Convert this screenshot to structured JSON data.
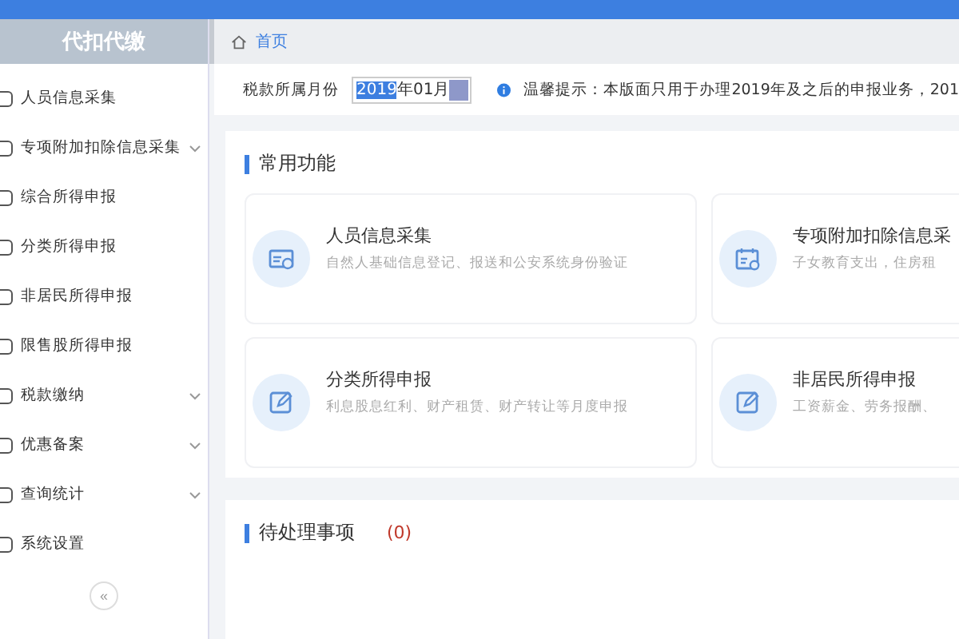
{
  "sidebar": {
    "title": "代扣代缴",
    "items": [
      {
        "label": "人员信息采集",
        "has_submenu": false
      },
      {
        "label": "专项附加扣除信息采集",
        "has_submenu": true
      },
      {
        "label": "综合所得申报",
        "has_submenu": false
      },
      {
        "label": "分类所得申报",
        "has_submenu": false
      },
      {
        "label": "非居民所得申报",
        "has_submenu": false
      },
      {
        "label": "限售股所得申报",
        "has_submenu": false
      },
      {
        "label": "税款缴纳",
        "has_submenu": true
      },
      {
        "label": "优惠备案",
        "has_submenu": true
      },
      {
        "label": "查询统计",
        "has_submenu": true
      },
      {
        "label": "系统设置",
        "has_submenu": false
      }
    ],
    "collapse": "«"
  },
  "breadcrumb": "首页",
  "filter": {
    "label": "税款所属月份",
    "value_selected": "2019",
    "value_rest": "年01月",
    "tip": "温馨提示：本版面只用于办理2019年及之后的申报业务，201"
  },
  "common": {
    "title": "常用功能",
    "cards": [
      {
        "kind": "id",
        "title": "人员信息采集",
        "desc": "自然人基础信息登记、报送和公安系统身份验证"
      },
      {
        "kind": "calendar",
        "title": "专项附加扣除信息采",
        "desc": "子女教育支出，住房租"
      },
      {
        "kind": "edit",
        "title": "分类所得申报",
        "desc": "利息股息红利、财产租赁、财产转让等月度申报"
      },
      {
        "kind": "edit",
        "title": "非居民所得申报",
        "desc": "工资薪金、劳务报酬、"
      }
    ]
  },
  "pending": {
    "title": "待处理事项",
    "count": "(0)"
  }
}
